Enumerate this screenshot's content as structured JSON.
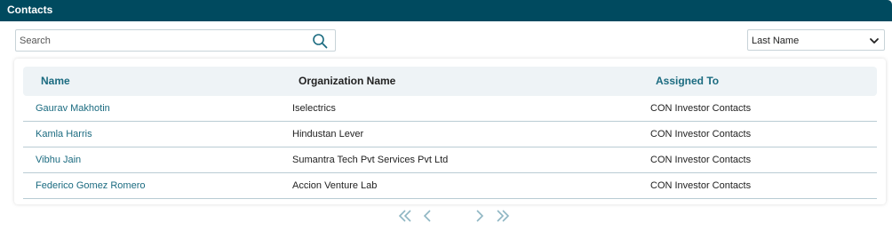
{
  "window": {
    "title": "Contacts"
  },
  "search": {
    "placeholder": "Search",
    "value": ""
  },
  "sort": {
    "selected": "Last Name"
  },
  "table": {
    "columns": [
      "Name",
      "Organization Name",
      "Assigned To"
    ],
    "rows": [
      {
        "name": "Gaurav Makhotin",
        "organization": "Iselectrics",
        "assigned_to": "CON Investor Contacts"
      },
      {
        "name": "Kamla Harris",
        "organization": "Hindustan Lever",
        "assigned_to": "CON Investor Contacts"
      },
      {
        "name": "Vibhu Jain",
        "organization": "Sumantra Tech Pvt Services Pvt Ltd",
        "assigned_to": "CON Investor Contacts"
      },
      {
        "name": "Federico Gomez Romero",
        "organization": "Accion Venture Lab",
        "assigned_to": "CON Investor Contacts"
      }
    ]
  },
  "colors": {
    "header_bg": "#004a5f",
    "accent": "#1b6b80",
    "table_header_bg": "#eef3f6",
    "row_divider": "#b9ccd4",
    "pager": "#8fb6c3"
  },
  "icons": {
    "search": "search-icon",
    "sort": "chevron-down-icon",
    "first": "double-chevron-left-icon",
    "prev": "chevron-left-icon",
    "next": "chevron-right-icon",
    "last": "double-chevron-right-icon"
  }
}
